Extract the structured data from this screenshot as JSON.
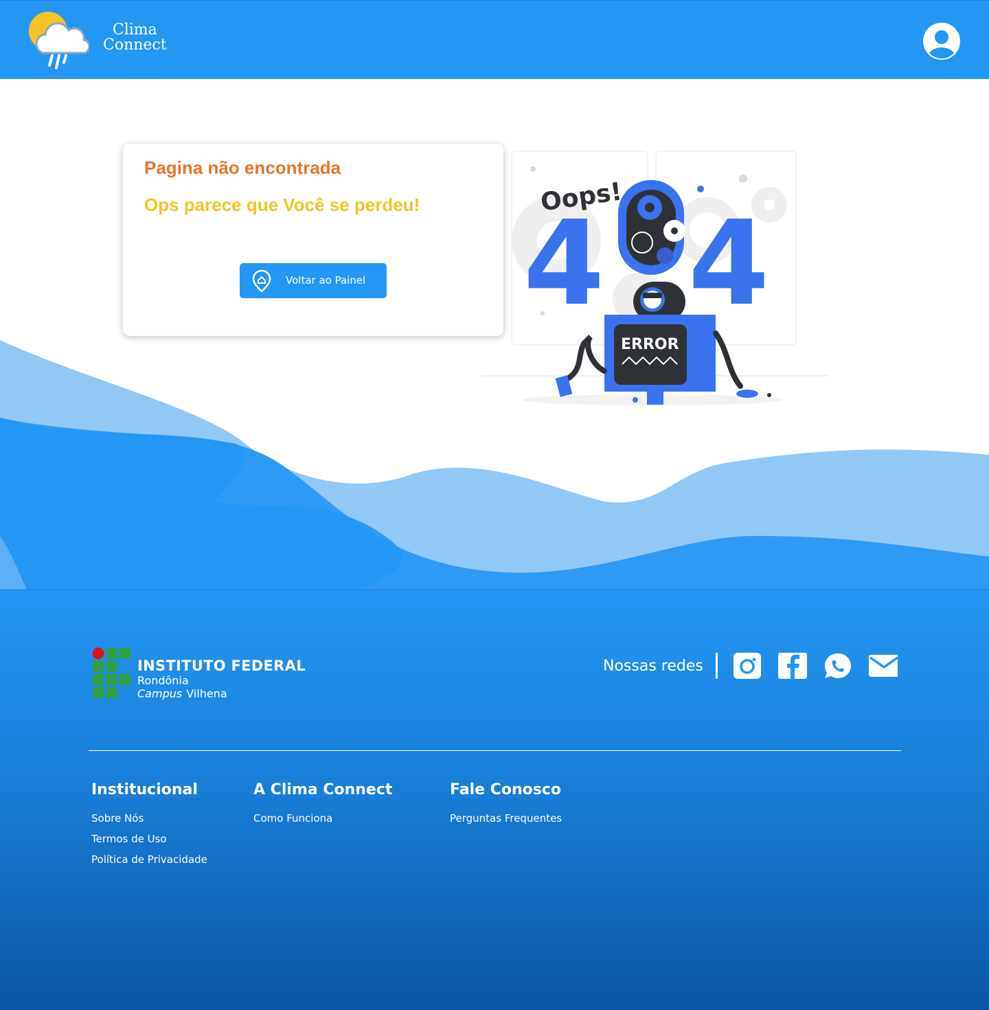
{
  "header": {
    "brand_line1": "Clima",
    "brand_line2": "Connect"
  },
  "card": {
    "title": "Pagina não encontrada",
    "subtitle": "Ops parece que Você se perdeu!",
    "button_label": "Voltar ao Painel"
  },
  "illustration": {
    "oops": "Oops!",
    "error": "ERROR"
  },
  "footer": {
    "institute_title": "INSTITUTO FEDERAL",
    "institute_state": "Rondônia",
    "institute_campus_word": "Campus",
    "institute_campus_name": "Vilhena",
    "social_label": "Nossas redes",
    "columns": [
      {
        "title": "Institucional",
        "links": [
          "Sobre Nós",
          "Termos de Uso",
          "Política de Privacidade"
        ]
      },
      {
        "title": "A Clima Connect",
        "links": [
          "Como Funciona"
        ]
      },
      {
        "title": "Fale Conosco",
        "links": [
          "Perguntas Frequentes"
        ]
      }
    ]
  },
  "colors": {
    "primary": "#2496f3",
    "title_orange": "#e8742a",
    "subtitle_yellow": "#f6c324",
    "wave_light": "#91c8f6",
    "footer_dark": "#0b56a3"
  },
  "icons": [
    "weather-logo-icon",
    "user-avatar-icon",
    "home-pin-icon",
    "instagram-icon",
    "facebook-icon",
    "whatsapp-icon",
    "email-icon"
  ]
}
